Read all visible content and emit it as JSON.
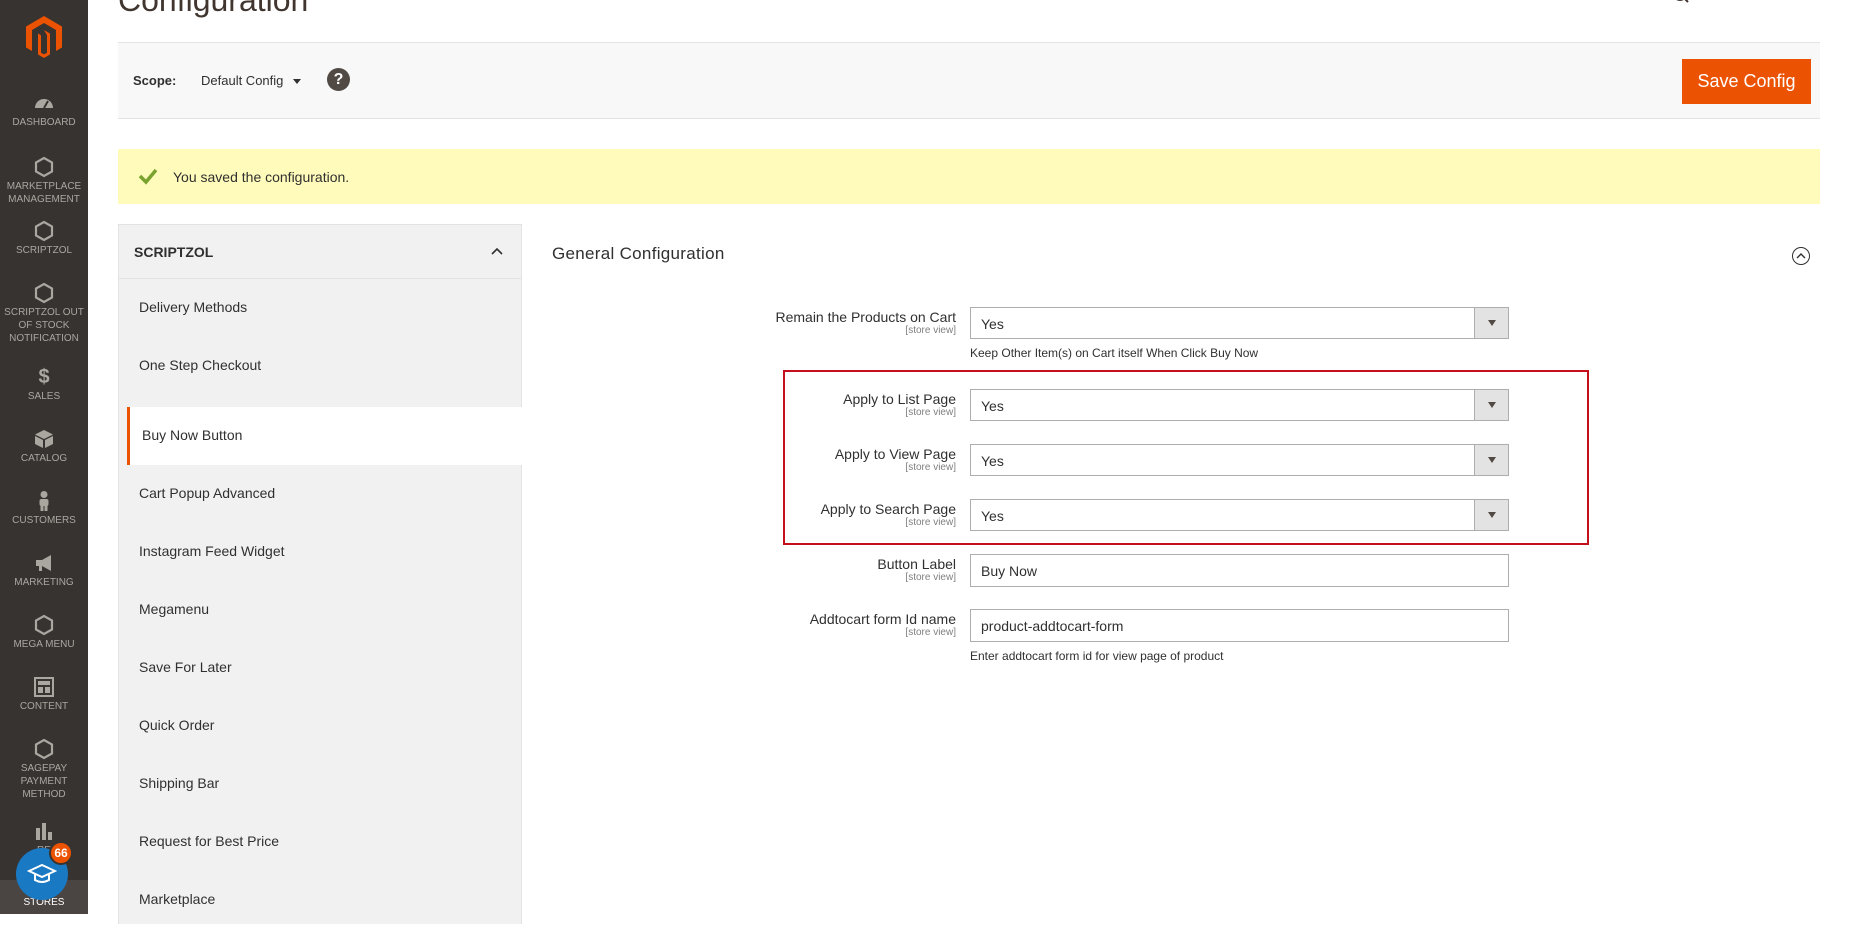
{
  "page": {
    "title": "Configuration"
  },
  "nav": {
    "items": [
      {
        "label": "DASHBOARD",
        "icon": "dashboard-icon"
      },
      {
        "label": "MARKETPLACE MANAGEMENT",
        "icon": "hexagon-icon"
      },
      {
        "label": "SCRIPTZOL",
        "icon": "hexagon-icon"
      },
      {
        "label": "SCRIPTZOL OUT OF STOCK NOTIFICATION",
        "icon": "hexagon-icon"
      },
      {
        "label": "SALES",
        "icon": "dollar-icon"
      },
      {
        "label": "CATALOG",
        "icon": "box-icon"
      },
      {
        "label": "CUSTOMERS",
        "icon": "person-icon"
      },
      {
        "label": "MARKETING",
        "icon": "megaphone-icon"
      },
      {
        "label": "MEGA MENU",
        "icon": "hexagon-icon"
      },
      {
        "label": "CONTENT",
        "icon": "layout-icon"
      },
      {
        "label": "SAGEPAY PAYMENT METHOD",
        "icon": "hexagon-icon"
      },
      {
        "label": "RE",
        "icon": "bar-chart-icon"
      },
      {
        "label": "STORES",
        "icon": "store-icon"
      }
    ],
    "badge_count": "66"
  },
  "scope": {
    "label": "Scope:",
    "value": "Default Config",
    "help": "?"
  },
  "toolbar": {
    "save_label": "Save Config"
  },
  "message": {
    "text": "You saved the configuration."
  },
  "tabs": {
    "group": "SCRIPTZOL",
    "items": [
      {
        "label": "Delivery Methods"
      },
      {
        "label": "One Step Checkout"
      },
      {
        "label": "Buy Now Button"
      },
      {
        "label": "Cart Popup Advanced"
      },
      {
        "label": "Instagram Feed Widget"
      },
      {
        "label": "Megamenu"
      },
      {
        "label": "Save For Later"
      },
      {
        "label": "Quick Order"
      },
      {
        "label": "Shipping Bar"
      },
      {
        "label": "Request for Best Price"
      },
      {
        "label": "Marketplace"
      }
    ],
    "active_index": 2
  },
  "section": {
    "title": "General Configuration",
    "fields": [
      {
        "label": "Remain the Products on Cart",
        "scope": "[store view]",
        "value": "Yes",
        "note": "Keep Other Item(s) on Cart itself When Click Buy Now"
      },
      {
        "label": "Apply to List Page",
        "scope": "[store view]",
        "value": "Yes"
      },
      {
        "label": "Apply to View Page",
        "scope": "[store view]",
        "value": "Yes"
      },
      {
        "label": "Apply to Search Page",
        "scope": "[store view]",
        "value": "Yes"
      },
      {
        "label": "Button Label",
        "scope": "[store view]",
        "value": "Buy Now"
      },
      {
        "label": "Addtocart form Id name",
        "scope": "[store view]",
        "value": "product-addtocart-form",
        "note": "Enter addtocart form id for view page of product"
      }
    ]
  },
  "colors": {
    "accent": "#eb5202",
    "nav_bg": "#373330",
    "message_bg": "#fffbbb",
    "highlight": "#c4101c"
  }
}
